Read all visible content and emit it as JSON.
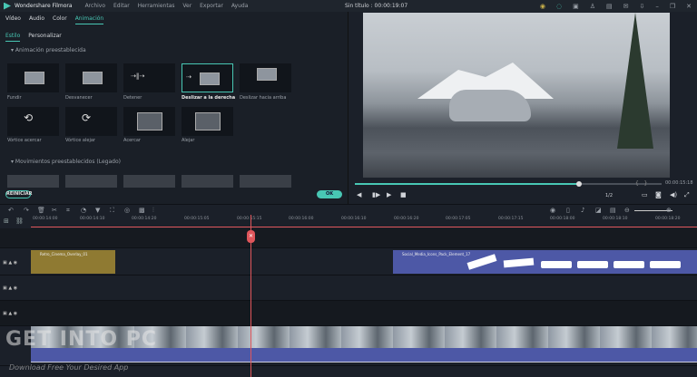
{
  "app": {
    "title": "Wondershare Filmora",
    "project": "Sin título : 00:00:19:07",
    "menu": [
      "Archivo",
      "Editar",
      "Herramientas",
      "Ver",
      "Exportar",
      "Ayuda"
    ]
  },
  "left_panel": {
    "tabs": [
      "Vídeo",
      "Audio",
      "Color",
      "Animación"
    ],
    "active_tab": "Animación",
    "subtabs": [
      "Estilo",
      "Personalizar"
    ],
    "active_subtab": "Estilo",
    "section_presets": "Animación preestablecida",
    "presets": [
      "Fundir",
      "Desvanecer",
      "Detener",
      "Deslizar a la derecha",
      "Deslizar hacia arriba",
      "Vórtice acercar",
      "Vórtice alejar",
      "Acercar",
      "Alejar"
    ],
    "selected_preset": "Deslizar a la derecha",
    "section_legacy": "Movimientos preestablecidos (Legado)",
    "reset_label": "REINICIAR",
    "ok_label": "OK"
  },
  "preview": {
    "timecode": "00:00:15:18",
    "progress": 0.73,
    "quality": "1/2"
  },
  "timeline": {
    "ruler": [
      "00:00:14:00",
      "00:00:14:10",
      "00:00:14:20",
      "00:00:15:05",
      "00:00:15:15",
      "00:00:16:00",
      "00:00:16:10",
      "00:00:16:20",
      "00:00:17:05",
      "00:00:17:15",
      "00:00:18:00",
      "00:00:18:10",
      "00:00:18:20"
    ],
    "clips": {
      "overlay": "Retro_Cinema_Overlay_01",
      "social": "Social_Media_Icons_Pack_Element_17"
    },
    "colors": {
      "accent": "#48c7b4",
      "playhead": "#e0565b",
      "overlay_clip": "#8f7a32",
      "social_clip": "#4d58a6"
    }
  },
  "watermark": {
    "logo": "GET INTO PC",
    "tagline": "Download Free Your Desired App"
  }
}
